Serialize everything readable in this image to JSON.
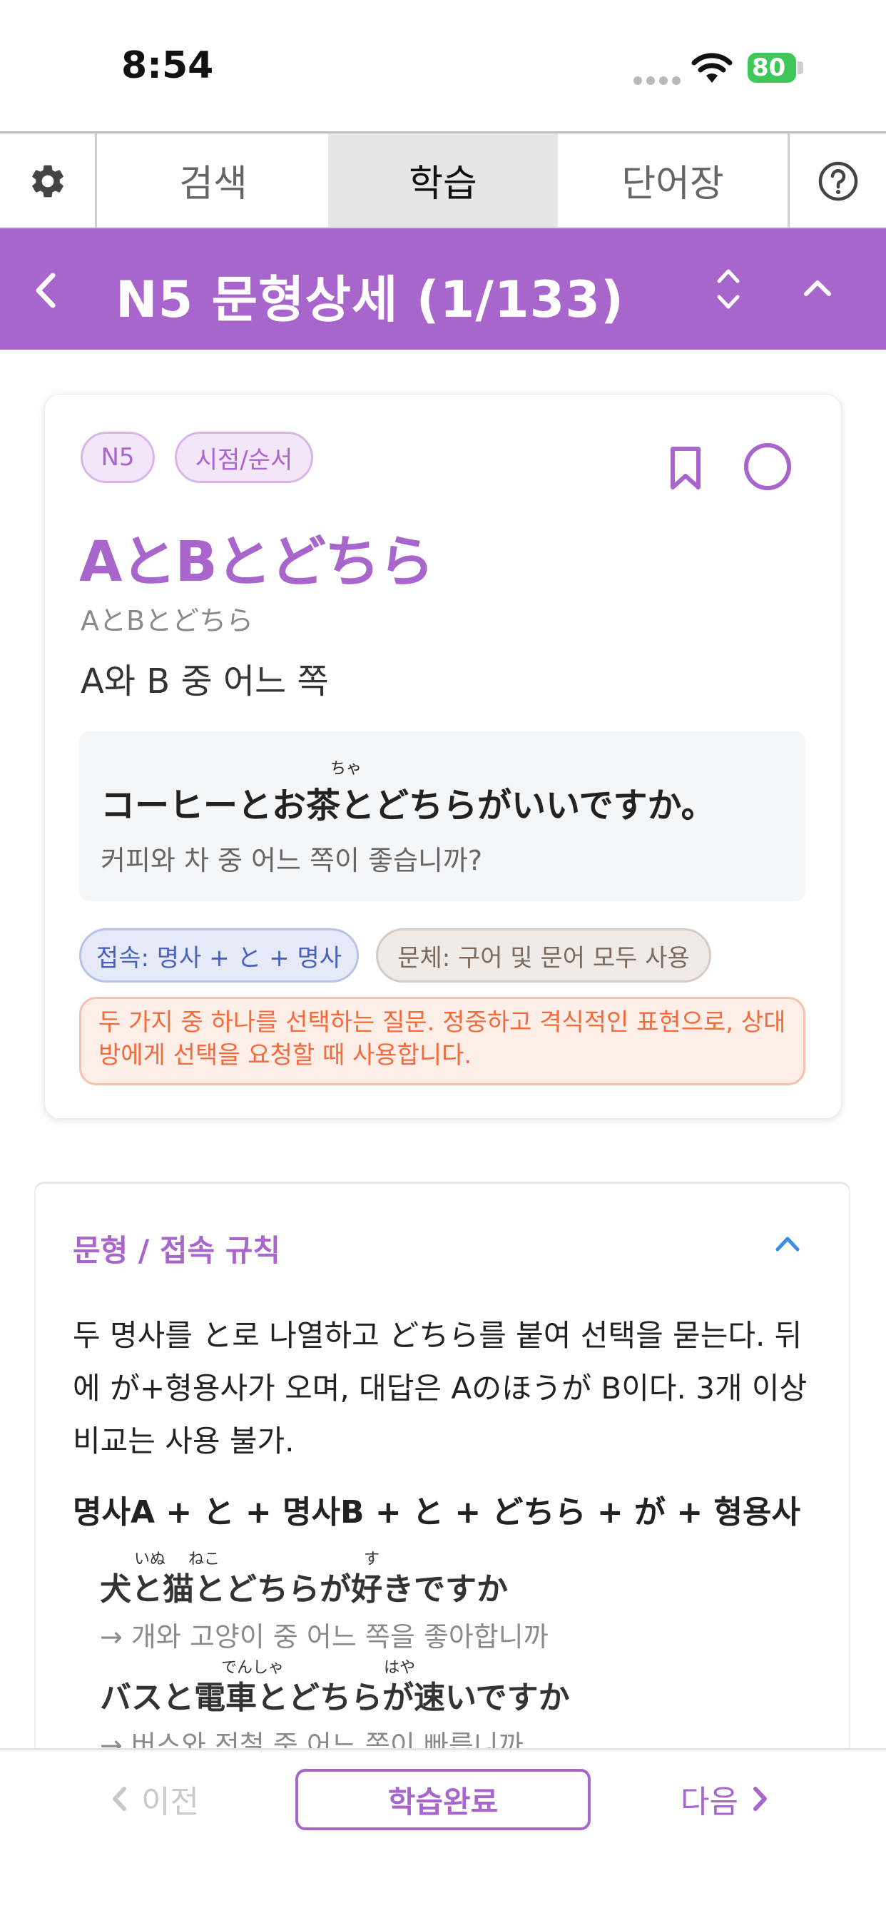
{
  "status": {
    "time": "8:54",
    "battery": "80"
  },
  "tabs": [
    {
      "label": "검색"
    },
    {
      "label": "학습"
    },
    {
      "label": "단어장"
    }
  ],
  "header": {
    "title": "N5 문형상세 (1/133)"
  },
  "card": {
    "level": "N5",
    "category": "시점/순서",
    "pattern": "AとBとどちら",
    "reading": "AとBとどちら",
    "meaning": "A와 B 중 어느 쪽",
    "example": {
      "ruby": "ちゃ",
      "jp": "コーヒーとお茶とどちらがいいですか。",
      "ko": "커피와 차 중 어느 쪽이 좋습니까?"
    },
    "connection": "접속: 명사 + と + 명사",
    "style": "문체: 구어 및 문어 모두 사용",
    "note": "두 가지 중 하나를 선택하는 질문. 정중하고 격식적인 표현으로, 상대방에게 선택을 요청할 때 사용합니다."
  },
  "rules": {
    "title": "문형 / 접속 규칙",
    "description": "두 명사를 と로 나열하고 どちら를 붙여 선택을 묻는다. 뒤에 が+형용사가 오며, 대답은 Aのほうが B이다. 3개 이상 비교는 사용 불가.",
    "formula": "명사A + と + 명사B + と + どちら + が + 형용사",
    "examples": [
      {
        "ruby1": "いぬ",
        "ruby2": "ねこ",
        "ruby3": "す",
        "jp": "犬と猫とどちらが好きですか",
        "ko": "→ 개와 고양이 중 어느 쪽을 좋아합니까"
      },
      {
        "ruby1": "でんしゃ",
        "ruby2": "はや",
        "jp": "バスと電車とどちらが速いですか",
        "ko": "→ 버스와 전철 중 어느 쪽이 빠릅니까"
      }
    ]
  },
  "bottom": {
    "prev": "이전",
    "complete": "학습완료",
    "next": "다음"
  },
  "colors": {
    "accent": "#a865cc",
    "connection": "#4a62b8",
    "note": "#f36b3b"
  }
}
